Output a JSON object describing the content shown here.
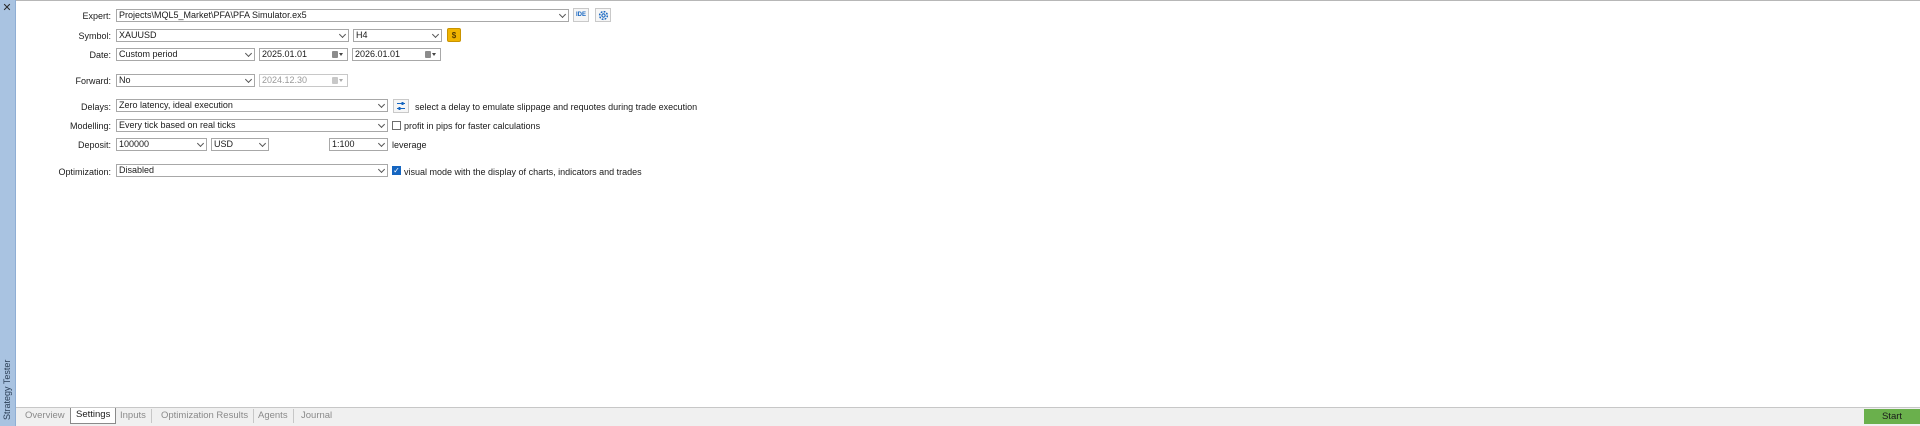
{
  "window": {
    "title": "Strategy Tester",
    "close_glyph": "✕"
  },
  "settings": {
    "expert": {
      "label": "Expert:",
      "value": "Projects\\MQL5_Market\\PFA\\PFA Simulator.ex5",
      "ide_label": "IDE"
    },
    "symbol": {
      "label": "Symbol:",
      "value": "XAUUSD",
      "timeframe": "H4",
      "spec_icon": "$"
    },
    "date": {
      "label": "Date:",
      "mode": "Custom period",
      "from": "2025.01.01",
      "to": "2026.01.01"
    },
    "forward": {
      "label": "Forward:",
      "mode": "No",
      "date": "2024.12.30"
    },
    "delays": {
      "label": "Delays:",
      "value": "Zero latency, ideal execution",
      "hint": "select a delay to emulate slippage and requotes during trade execution"
    },
    "modelling": {
      "label": "Modelling:",
      "value": "Every tick based on real ticks",
      "pips_label": "profit in pips for faster calculations",
      "pips_checked": false
    },
    "deposit": {
      "label": "Deposit:",
      "amount": "100000",
      "currency": "USD",
      "leverage": "1:100",
      "leverage_label": "leverage"
    },
    "optimization": {
      "label": "Optimization:",
      "value": "Disabled",
      "visual_label": "visual mode with the display of charts, indicators and trades",
      "visual_checked": true
    }
  },
  "tabs": [
    {
      "label": "Overview"
    },
    {
      "label": "Settings"
    },
    {
      "label": "Inputs"
    },
    {
      "label": "Optimization Results"
    },
    {
      "label": "Agents"
    },
    {
      "label": "Journal"
    }
  ],
  "active_tab": "Settings",
  "start_button": "Start",
  "colors": {
    "accent": "#1565c0",
    "start": "#6ab04c",
    "sidebar": "#a9c3e1",
    "spec": "#f0b400"
  }
}
